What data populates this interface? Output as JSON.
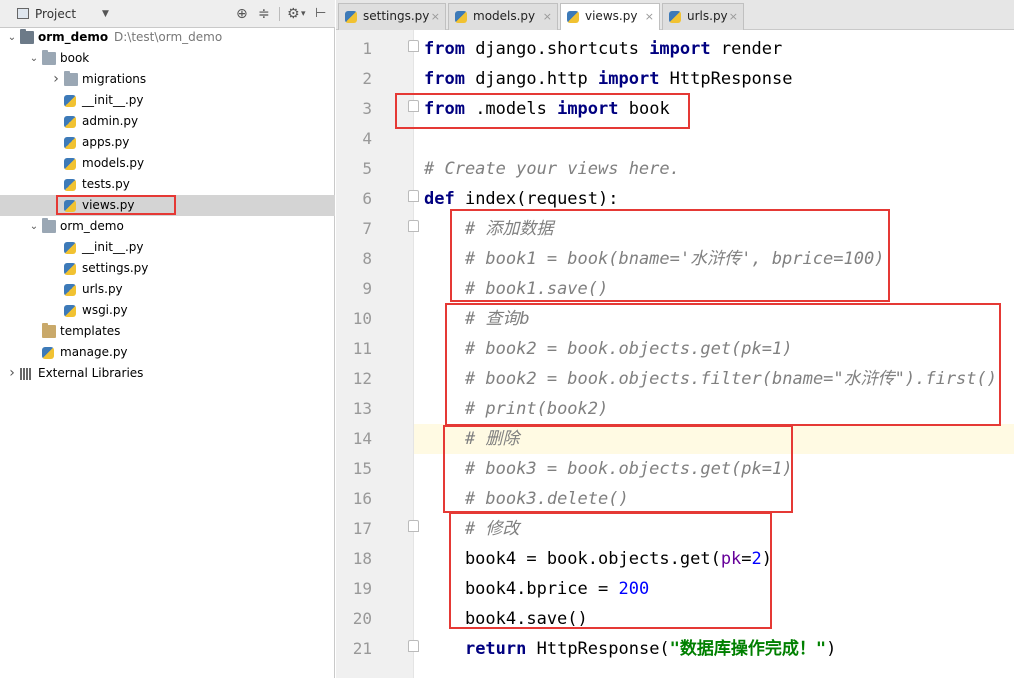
{
  "project_panel": {
    "title": "Project",
    "tree": [
      {
        "label": "orm_demo",
        "path": "D:\\test\\orm_demo",
        "icon": "folder-dark",
        "arrow": "down",
        "depth": 0,
        "bold": true
      },
      {
        "label": "book",
        "icon": "folder",
        "arrow": "down",
        "depth": 1
      },
      {
        "label": "migrations",
        "icon": "folder",
        "arrow": "right",
        "depth": 2
      },
      {
        "label": "__init__.py",
        "icon": "python-file",
        "depth": 2
      },
      {
        "label": "admin.py",
        "icon": "python-file",
        "depth": 2
      },
      {
        "label": "apps.py",
        "icon": "python-file",
        "depth": 2
      },
      {
        "label": "models.py",
        "icon": "python-file",
        "depth": 2
      },
      {
        "label": "tests.py",
        "icon": "python-file",
        "depth": 2
      },
      {
        "label": "views.py",
        "icon": "python-file",
        "depth": 2,
        "selected": true
      },
      {
        "label": "orm_demo",
        "icon": "folder",
        "arrow": "down",
        "depth": 1
      },
      {
        "label": "__init__.py",
        "icon": "python-file",
        "depth": 2
      },
      {
        "label": "settings.py",
        "icon": "python-file",
        "depth": 2
      },
      {
        "label": "urls.py",
        "icon": "python-file",
        "depth": 2
      },
      {
        "label": "wsgi.py",
        "icon": "python-file",
        "depth": 2
      },
      {
        "label": "templates",
        "icon": "folder-templates",
        "depth": 1
      },
      {
        "label": "manage.py",
        "icon": "python-file",
        "depth": 1
      },
      {
        "label": "External Libraries",
        "icon": "libraries",
        "arrow": "right",
        "depth": 0
      }
    ]
  },
  "tabs": [
    {
      "label": "settings.py",
      "active": false
    },
    {
      "label": "models.py",
      "active": false
    },
    {
      "label": "views.py",
      "active": true
    },
    {
      "label": "urls.py",
      "active": false
    }
  ],
  "editor": {
    "current_line": 14,
    "lines": [
      [
        [
          "kw",
          "from"
        ],
        [
          "t",
          " django.shortcuts "
        ],
        [
          "kw",
          "import"
        ],
        [
          "t",
          " render"
        ]
      ],
      [
        [
          "kw",
          "from"
        ],
        [
          "t",
          " django.http "
        ],
        [
          "kw",
          "import"
        ],
        [
          "t",
          " HttpResponse"
        ]
      ],
      [
        [
          "kw",
          "from"
        ],
        [
          "t",
          " .models "
        ],
        [
          "kw",
          "import"
        ],
        [
          "t",
          " book"
        ]
      ],
      [],
      [
        [
          "cm",
          "# Create your views here."
        ]
      ],
      [
        [
          "kw",
          "def"
        ],
        [
          "t",
          " index(request):"
        ]
      ],
      [
        [
          "t",
          "    "
        ],
        [
          "cm",
          "# 添加数据"
        ]
      ],
      [
        [
          "t",
          "    "
        ],
        [
          "cm",
          "# book1 = book(bname='水浒传', bprice=100)"
        ]
      ],
      [
        [
          "t",
          "    "
        ],
        [
          "cm",
          "# book1.save()"
        ]
      ],
      [
        [
          "t",
          "    "
        ],
        [
          "cm",
          "# 查询b"
        ]
      ],
      [
        [
          "t",
          "    "
        ],
        [
          "cm",
          "# book2 = book.objects.get(pk=1)"
        ]
      ],
      [
        [
          "t",
          "    "
        ],
        [
          "cm",
          "# book2 = book.objects.filter(bname=\"水浒传\").first()"
        ]
      ],
      [
        [
          "t",
          "    "
        ],
        [
          "cm",
          "# print(book2)"
        ]
      ],
      [
        [
          "t",
          "    "
        ],
        [
          "cm",
          "# 删除"
        ]
      ],
      [
        [
          "t",
          "    "
        ],
        [
          "cm",
          "# book3 = book.objects.get(pk=1)"
        ]
      ],
      [
        [
          "t",
          "    "
        ],
        [
          "cm",
          "# book3.delete()"
        ]
      ],
      [
        [
          "t",
          "    "
        ],
        [
          "cm",
          "# 修改"
        ]
      ],
      [
        [
          "t",
          "    book4 = book.objects.get("
        ],
        [
          "par",
          "pk"
        ],
        [
          "t",
          "="
        ],
        [
          "num",
          "2"
        ],
        [
          "t",
          ")"
        ]
      ],
      [
        [
          "t",
          "    book4.bprice = "
        ],
        [
          "num",
          "200"
        ]
      ],
      [
        [
          "t",
          "    book4.save()"
        ]
      ],
      [
        [
          "t",
          "    "
        ],
        [
          "kw",
          "return"
        ],
        [
          "t",
          " HttpResponse("
        ],
        [
          "str",
          "\"数据库操作完成！\""
        ],
        [
          "t",
          ")"
        ]
      ]
    ]
  },
  "colors": {
    "annotation_box": "#e53935",
    "keyword": "#000080",
    "comment": "#808080",
    "number": "#0000ff",
    "string": "#008000",
    "current_line": "#fffae3"
  }
}
